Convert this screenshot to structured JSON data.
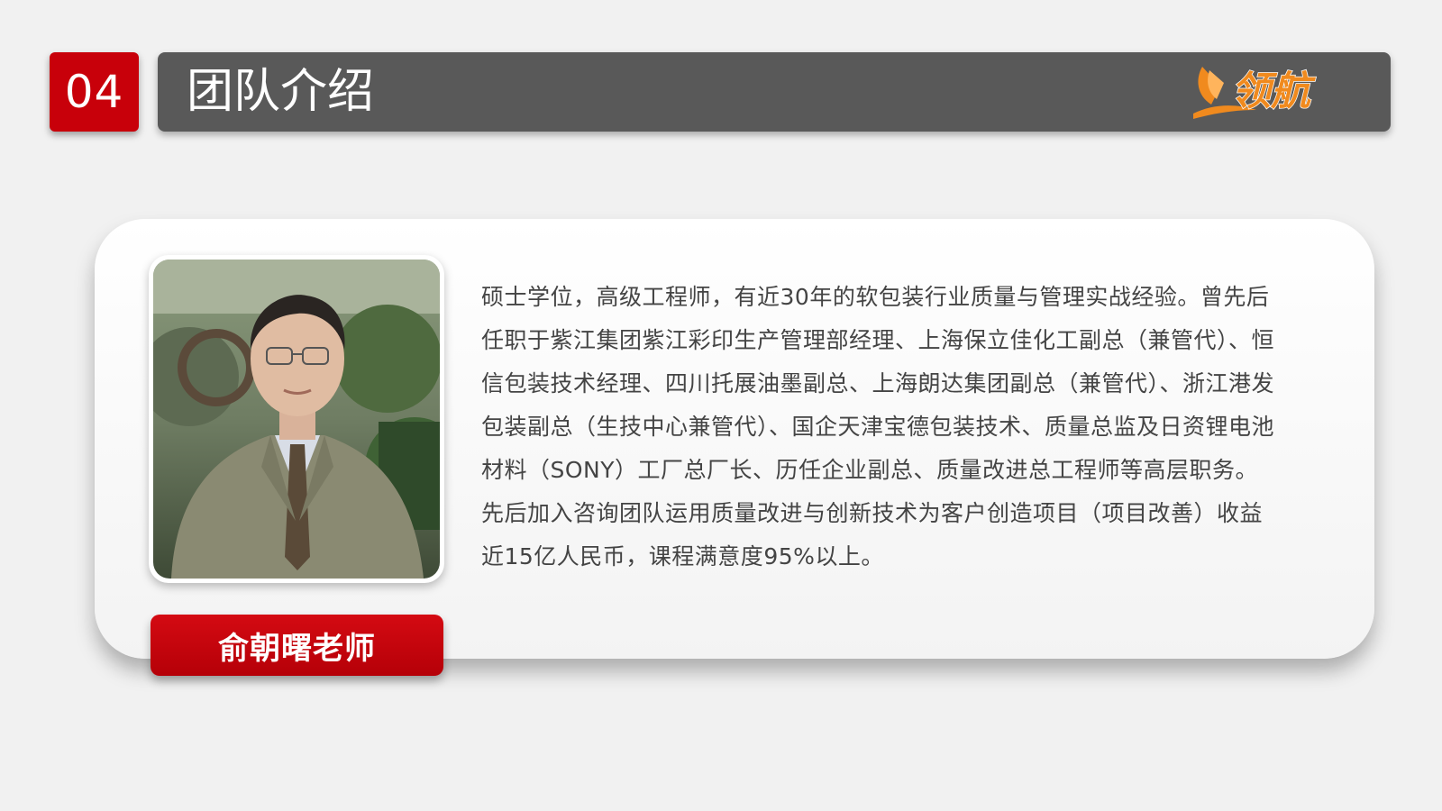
{
  "header": {
    "number": "04",
    "title": "团队介绍",
    "logo_text": "领航"
  },
  "profile": {
    "name": "俞朝曙老师",
    "photo_label": "teacher-portrait",
    "bio": "硕士学位，高级工程师，有近30年的软包装行业质量与管理实战经验。曾先后任职于紫江集团紫江彩印生产管理部经理、上海保立佳化工副总（兼管代）、恒信包装技术经理、四川托展油墨副总、上海朗达集团副总（兼管代）、浙江港发包装副总（生技中心兼管代）、国企天津宝德包装技术、质量总监及日资锂电池材料（SONY）工厂总厂长、历任企业副总、质量改进总工程师等高层职务。先后加入咨询团队运用质量改进与创新技术为客户创造项目（项目改善）收益近15亿人民币，课程满意度95%以上。"
  },
  "colors": {
    "accent_red": "#c8000a",
    "title_bar": "#595959",
    "logo_orange": "#f08a1e"
  }
}
